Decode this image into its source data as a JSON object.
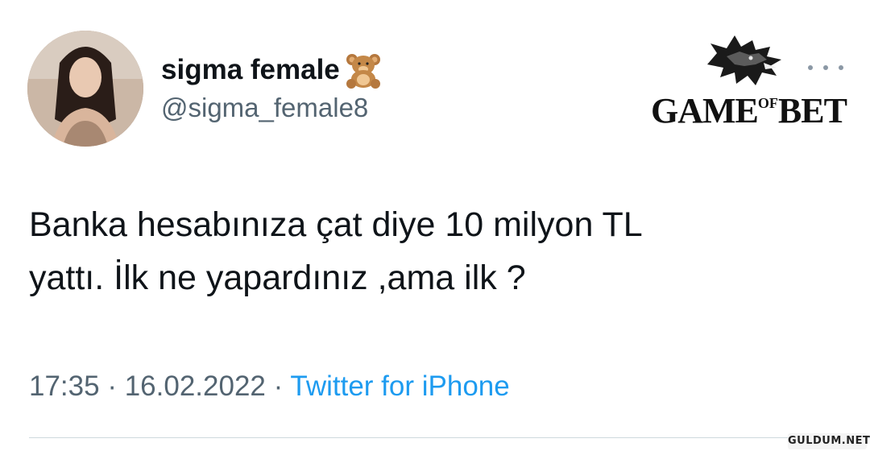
{
  "user": {
    "display_name": "sigma female",
    "name_emoji": "teddy-bear-emoji",
    "handle": "@sigma_female8"
  },
  "tweet": {
    "lines": [
      "Banka hesabınıza çat diye 10 milyon TL",
      "yattı. İlk ne yapardınız ,ama ilk ?"
    ]
  },
  "meta": {
    "time": "17:35",
    "separator": "·",
    "date": "16.02.2022",
    "source": "Twitter for iPhone"
  },
  "watermark": {
    "brand_part1": "GAME",
    "brand_part2": "OF",
    "brand_part3": "BET",
    "logo": "wolf-head-icon"
  },
  "site_badge": "GULDUM.NET",
  "icons": {
    "more": "more-horizontal-icon"
  },
  "colors": {
    "text_primary": "#0f1419",
    "text_secondary": "#536471",
    "link": "#1d9bf0",
    "divider": "#cfd9de"
  }
}
